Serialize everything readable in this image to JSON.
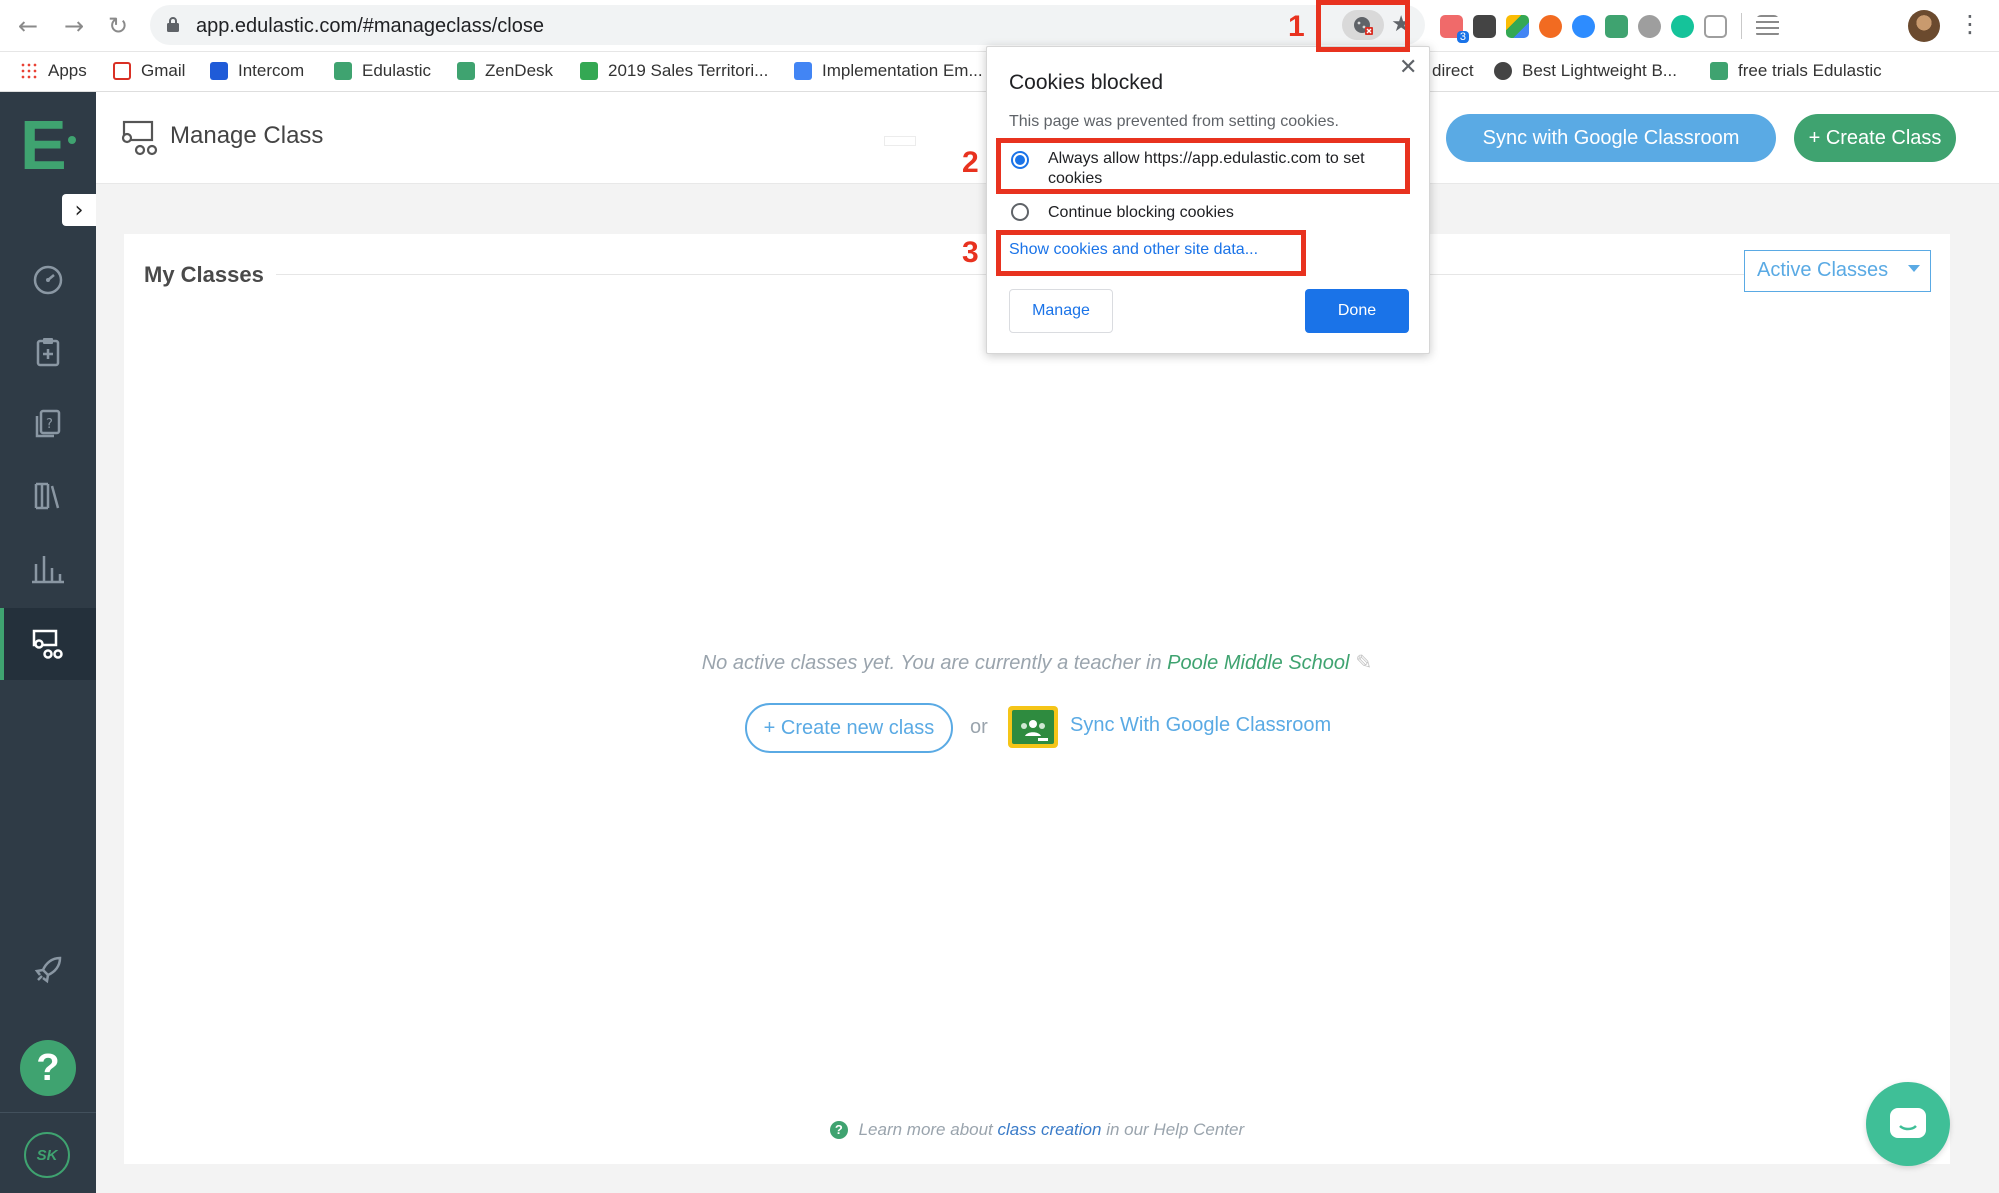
{
  "browser": {
    "url": "app.edulastic.com/#manageclass/close",
    "extension_badge": "3"
  },
  "bookmarks": [
    {
      "label": "Apps",
      "icon": "apps-grid-icon",
      "color": "#e94235"
    },
    {
      "label": "Gmail",
      "icon": "gmail-icon",
      "color": "#d93025"
    },
    {
      "label": "Intercom",
      "icon": "intercom-icon",
      "color": "#1f5bd8"
    },
    {
      "label": "Edulastic",
      "icon": "edulastic-icon",
      "color": "#3fa370"
    },
    {
      "label": "ZenDesk",
      "icon": "edulastic-icon",
      "color": "#3fa370"
    },
    {
      "label": "2019 Sales Territori...",
      "icon": "sheets-icon",
      "color": "#34a853"
    },
    {
      "label": "Implementation Em...",
      "icon": "docs-icon",
      "color": "#4285f4"
    },
    {
      "label": "direct",
      "icon": "direct-icon",
      "color": "#ffffff"
    },
    {
      "label": "Best Lightweight B...",
      "icon": "hiking-icon",
      "color": "#444444"
    },
    {
      "label": "free trials Edulastic",
      "icon": "edulastic-icon",
      "color": "#3fa370"
    }
  ],
  "header": {
    "title": "Manage Class",
    "sync_button": "Sync with Google Classroom",
    "create_button": "+ Create Class"
  },
  "card": {
    "title": "My Classes",
    "filter": "Active Classes",
    "empty_prefix": "No active classes yet. You are currently a teacher in",
    "school": "Poole Middle School",
    "create_new": "+ Create new class",
    "or": "or",
    "sync_link": "Sync With Google Classroom",
    "learn_prefix": "Learn more about",
    "learn_link": "class creation",
    "learn_suffix": "in our Help Center"
  },
  "sidebar": {
    "avatar_initials": "SK",
    "help": "?"
  },
  "popup": {
    "title": "Cookies blocked",
    "description": "This page was prevented from setting cookies.",
    "option_allow": "Always allow https://app.edulastic.com to set cookies",
    "option_block": "Continue blocking cookies",
    "show_link": "Show cookies and other site data...",
    "manage": "Manage",
    "done": "Done"
  },
  "annotations": {
    "step1": "1",
    "step2": "2",
    "step3": "3",
    "color": "#e8321f"
  },
  "colors": {
    "brand_green": "#3fa370",
    "accent_blue": "#5aaae4",
    "sidebar_bg": "#2f3b46",
    "chrome_blue": "#1a73e8"
  }
}
